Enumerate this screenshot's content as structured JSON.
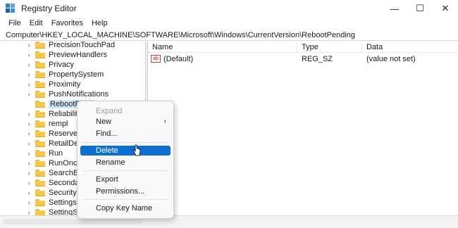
{
  "window": {
    "title": "Registry Editor",
    "controls": [
      "—",
      "☐",
      "✕"
    ]
  },
  "menu": {
    "items": [
      "File",
      "Edit",
      "Favorites",
      "Help"
    ]
  },
  "address": {
    "path": "Computer\\HKEY_LOCAL_MACHINE\\SOFTWARE\\Microsoft\\Windows\\CurrentVersion\\RebootPending"
  },
  "tree": {
    "items": [
      {
        "label": "PrecisionTouchPad"
      },
      {
        "label": "PreviewHandlers"
      },
      {
        "label": "Privacy"
      },
      {
        "label": "PropertySystem"
      },
      {
        "label": "Proximity"
      },
      {
        "label": "PushNotifications"
      },
      {
        "label": "RebootPend",
        "selected": true
      },
      {
        "label": "Reliability"
      },
      {
        "label": "rempl"
      },
      {
        "label": "ReserveMan"
      },
      {
        "label": "RetailDemo"
      },
      {
        "label": "Run"
      },
      {
        "label": "RunOnce"
      },
      {
        "label": "SearchBoxE"
      },
      {
        "label": "SecondaryA"
      },
      {
        "label": "Security and"
      },
      {
        "label": "Settings"
      },
      {
        "label": "SettingSync"
      }
    ]
  },
  "list": {
    "headers": {
      "name": "Name",
      "type": "Type",
      "data": "Data"
    },
    "rows": [
      {
        "icon": "ab",
        "name": "(Default)",
        "type": "REG_SZ",
        "data": "(value not set)"
      }
    ]
  },
  "context_menu": {
    "expand": "Expand",
    "new": "New",
    "find": "Find...",
    "delete": "Delete",
    "rename": "Rename",
    "export": "Export",
    "permissions": "Permissions...",
    "copy_key_name": "Copy Key Name"
  },
  "colors": {
    "highlight": "#0f6fd0",
    "selection": "#cce4f7",
    "folder": "#f5c84c"
  }
}
